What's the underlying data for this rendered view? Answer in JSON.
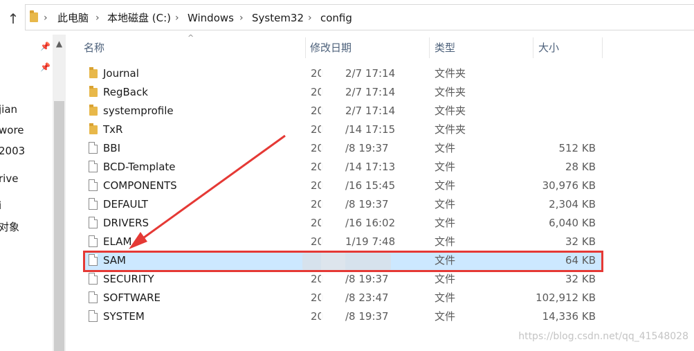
{
  "address_bar": {
    "crumbs": [
      "此电脑",
      "本地磁盘 (C:)",
      "Windows",
      "System32",
      "config"
    ]
  },
  "nav": {
    "items": [
      "jian",
      "wore",
      "2003",
      "rive",
      "i",
      "对象"
    ]
  },
  "columns": {
    "name": "名称",
    "modified": "修改日期",
    "type": "类型",
    "size": "大小"
  },
  "rows": [
    {
      "name": "Journal",
      "date_a": "20",
      "date_b": "2/7 17:14",
      "type": "文件夹",
      "size": "",
      "kind": "folder"
    },
    {
      "name": "RegBack",
      "date_a": "20",
      "date_b": "2/7 17:14",
      "type": "文件夹",
      "size": "",
      "kind": "folder"
    },
    {
      "name": "systemprofile",
      "date_a": "20",
      "date_b": "2/7 17:14",
      "type": "文件夹",
      "size": "",
      "kind": "folder"
    },
    {
      "name": "TxR",
      "date_a": "20",
      "date_b": "/14 17:15",
      "type": "文件夹",
      "size": "",
      "kind": "folder"
    },
    {
      "name": "BBI",
      "date_a": "20",
      "date_b": "/8 19:37",
      "type": "文件",
      "size": "512 KB",
      "kind": "file"
    },
    {
      "name": "BCD-Template",
      "date_a": "20",
      "date_b": "/14 17:13",
      "type": "文件",
      "size": "28 KB",
      "kind": "file"
    },
    {
      "name": "COMPONENTS",
      "date_a": "20",
      "date_b": "/16 15:45",
      "type": "文件",
      "size": "30,976 KB",
      "kind": "file"
    },
    {
      "name": "DEFAULT",
      "date_a": "20",
      "date_b": "/8 19:37",
      "type": "文件",
      "size": "2,304 KB",
      "kind": "file"
    },
    {
      "name": "DRIVERS",
      "date_a": "20",
      "date_b": "/16 16:02",
      "type": "文件",
      "size": "6,040 KB",
      "kind": "file"
    },
    {
      "name": "ELAM",
      "date_a": "20",
      "date_b": "1/19 7:48",
      "type": "文件",
      "size": "32 KB",
      "kind": "file"
    },
    {
      "name": "SAM",
      "date_a": "",
      "date_b": "",
      "type": "文件",
      "size": "64 KB",
      "kind": "file",
      "selected": true
    },
    {
      "name": "SECURITY",
      "date_a": "20",
      "date_b": "/8 19:37",
      "type": "文件",
      "size": "32 KB",
      "kind": "file"
    },
    {
      "name": "SOFTWARE",
      "date_a": "20",
      "date_b": "/8 23:47",
      "type": "文件",
      "size": "102,912 KB",
      "kind": "file"
    },
    {
      "name": "SYSTEM",
      "date_a": "20",
      "date_b": "/8 19:37",
      "type": "文件",
      "size": "14,336 KB",
      "kind": "file"
    }
  ],
  "watermark": "https://blog.csdn.net/qq_41548028",
  "colors": {
    "selected_row": "#cce8ff",
    "highlight_box": "#e53935",
    "arrow": "#e53935",
    "header_text": "#4c607a"
  }
}
